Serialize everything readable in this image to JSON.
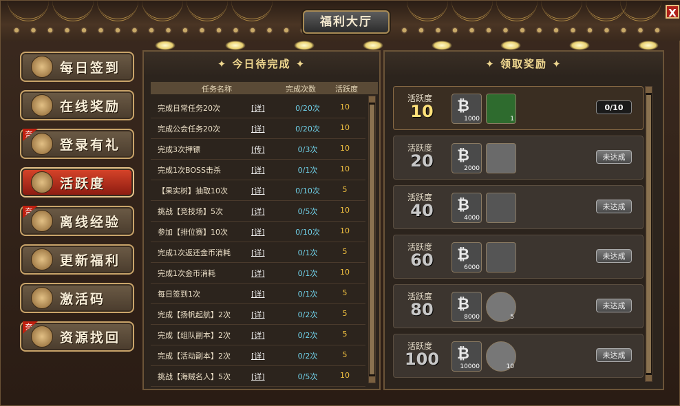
{
  "window": {
    "title": "福利大厅",
    "close_label": "X"
  },
  "nav": [
    {
      "label": "每日签到",
      "icon": "scroll-icon",
      "tag": ""
    },
    {
      "label": "在线奖励",
      "icon": "chest-icon",
      "tag": ""
    },
    {
      "label": "登录有礼",
      "icon": "seven-icon",
      "tag": "奈"
    },
    {
      "label": "活跃度",
      "icon": "face-icon",
      "tag": "",
      "active": true
    },
    {
      "label": "离线经验",
      "icon": "shield-icon",
      "tag": "奈"
    },
    {
      "label": "更新福利",
      "icon": "treasure-icon",
      "tag": ""
    },
    {
      "label": "激活码",
      "icon": "giftbox-icon",
      "tag": ""
    },
    {
      "label": "资源找回",
      "icon": "jar-icon",
      "tag": "奈"
    }
  ],
  "tasks": {
    "heading": "今日待完成",
    "columns": {
      "name": "任务名称",
      "count": "完成次数",
      "activity": "活跃度"
    },
    "rows": [
      {
        "name": "完成日常任务20次",
        "detail": "[详]",
        "count": "0/20次",
        "activity": "10"
      },
      {
        "name": "完成公会任务20次",
        "detail": "[详]",
        "count": "0/20次",
        "activity": "10"
      },
      {
        "name": "完成3次押镖",
        "detail": "[传]",
        "count": "0/3次",
        "activity": "10"
      },
      {
        "name": "完成1次BOSS击杀",
        "detail": "[详]",
        "count": "0/1次",
        "activity": "10"
      },
      {
        "name": "【果实树】抽取10次",
        "detail": "[详]",
        "count": "0/10次",
        "activity": "5"
      },
      {
        "name": "挑战【竞技场】5次",
        "detail": "[详]",
        "count": "0/5次",
        "activity": "10"
      },
      {
        "name": "参加【排位赛】10次",
        "detail": "[详]",
        "count": "0/10次",
        "activity": "10"
      },
      {
        "name": "完成1次返还金币消耗",
        "detail": "[详]",
        "count": "0/1次",
        "activity": "5"
      },
      {
        "name": "完成1次金币消耗",
        "detail": "[详]",
        "count": "0/1次",
        "activity": "10"
      },
      {
        "name": "每日签到1次",
        "detail": "[详]",
        "count": "0/1次",
        "activity": "5"
      },
      {
        "name": "完成【扬帆起航】2次",
        "detail": "[详]",
        "count": "0/2次",
        "activity": "5"
      },
      {
        "name": "完成【组队副本】2次",
        "detail": "[详]",
        "count": "0/2次",
        "activity": "5"
      },
      {
        "name": "完成【活动副本】2次",
        "detail": "[详]",
        "count": "0/2次",
        "activity": "5"
      },
      {
        "name": "挑战【海贼名人】5次",
        "detail": "[详]",
        "count": "0/5次",
        "activity": "10"
      }
    ]
  },
  "rewards": {
    "heading": "领取奖励",
    "label": "活跃度",
    "items": [
      {
        "level": "10",
        "coin_amount": "1000",
        "item_amount": "1",
        "button": "0/10",
        "item_icon": "book-icon"
      },
      {
        "level": "20",
        "coin_amount": "2000",
        "item_amount": "",
        "button": "未达成",
        "item_icon": "snail-icon"
      },
      {
        "level": "40",
        "coin_amount": "4000",
        "item_amount": "",
        "button": "未达成",
        "item_icon": "potion-icon"
      },
      {
        "level": "60",
        "coin_amount": "6000",
        "item_amount": "",
        "button": "未达成",
        "item_icon": "potion-icon"
      },
      {
        "level": "80",
        "coin_amount": "8000",
        "item_amount": "5",
        "button": "未达成",
        "item_icon": "coin-icon"
      },
      {
        "level": "100",
        "coin_amount": "10000",
        "item_amount": "10",
        "button": "未达成",
        "item_icon": "coin-icon"
      }
    ]
  }
}
